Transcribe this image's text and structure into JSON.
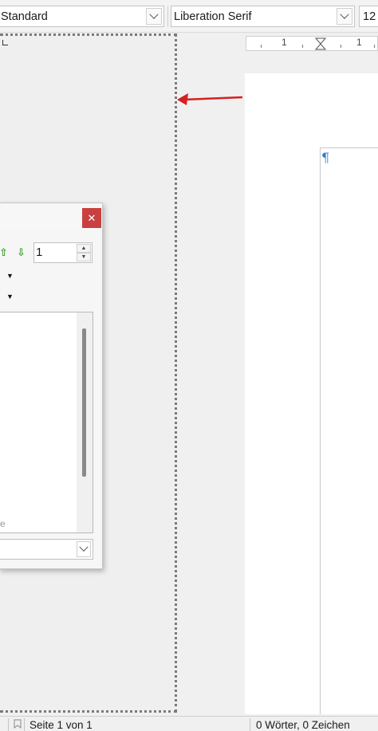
{
  "toolbar": {
    "paragraph_style": "Standard",
    "font_name": "Liberation Serif",
    "font_size": "12"
  },
  "ruler": {
    "labels": [
      "1",
      "1"
    ]
  },
  "document": {
    "formatting_mark": "¶"
  },
  "navigator_dialog": {
    "close_symbol": "✕",
    "up_symbol": "⇧",
    "down_symbol": "⇩",
    "page_number": "1",
    "spin_up": "▲",
    "spin_down": "▼",
    "dropdown_symbol": "▼",
    "list_fragment": "e"
  },
  "statusbar": {
    "page_info": "Seite 1 von 1",
    "word_count": "0 Wörter, 0 Zeichen"
  },
  "colors": {
    "close_button": "#c94040",
    "arrow": "#d42020",
    "pilcrow": "#2a7fd0",
    "navigate_arrows": "#3a9c2a"
  }
}
